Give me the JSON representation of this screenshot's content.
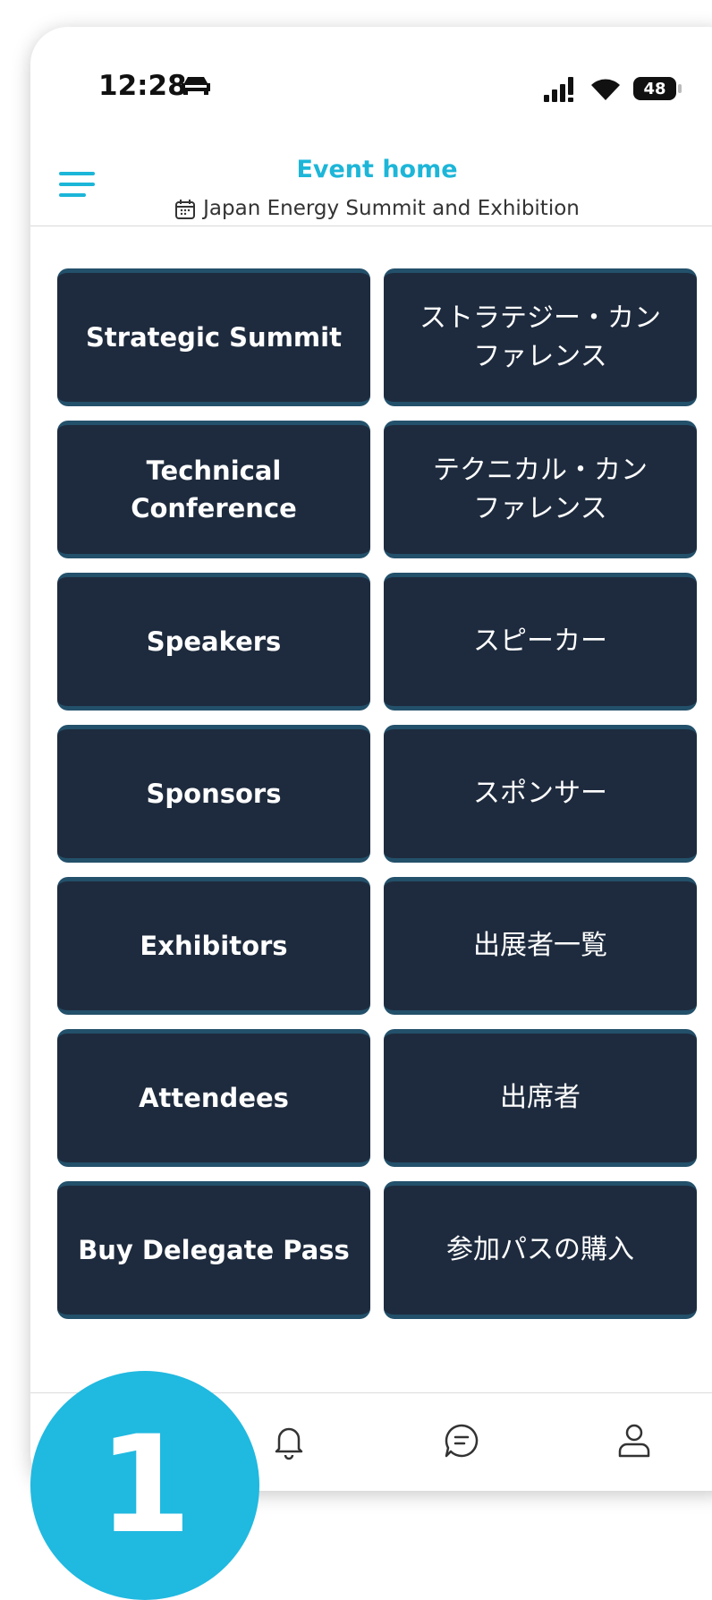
{
  "status_bar": {
    "time": "12:28",
    "battery": "48"
  },
  "header": {
    "title": "Event home",
    "subtitle": "Japan Energy Summit and Exhibition"
  },
  "tiles": [
    {
      "en": "Strategic Summit",
      "jp": "ストラテジー・カン\nファレンス"
    },
    {
      "en": "Technical\nConference",
      "jp": "テクニカル・カン\nファレンス"
    },
    {
      "en": "Speakers",
      "jp": "スピーカー"
    },
    {
      "en": "Sponsors",
      "jp": "スポンサー"
    },
    {
      "en": "Exhibitors",
      "jp": "出展者一覧"
    },
    {
      "en": "Attendees",
      "jp": "出席者"
    },
    {
      "en": "Buy Delegate Pass",
      "jp": "参加パスの購入"
    }
  ],
  "tab_bar": {
    "icons": [
      "home-icon",
      "bell-icon",
      "chat-icon",
      "user-icon"
    ]
  },
  "step_badge": "1",
  "colors": {
    "accent": "#1db6d8",
    "tile_bg": "#1e2b3e",
    "tile_border": "#23506a",
    "badge": "#20b9e0"
  }
}
